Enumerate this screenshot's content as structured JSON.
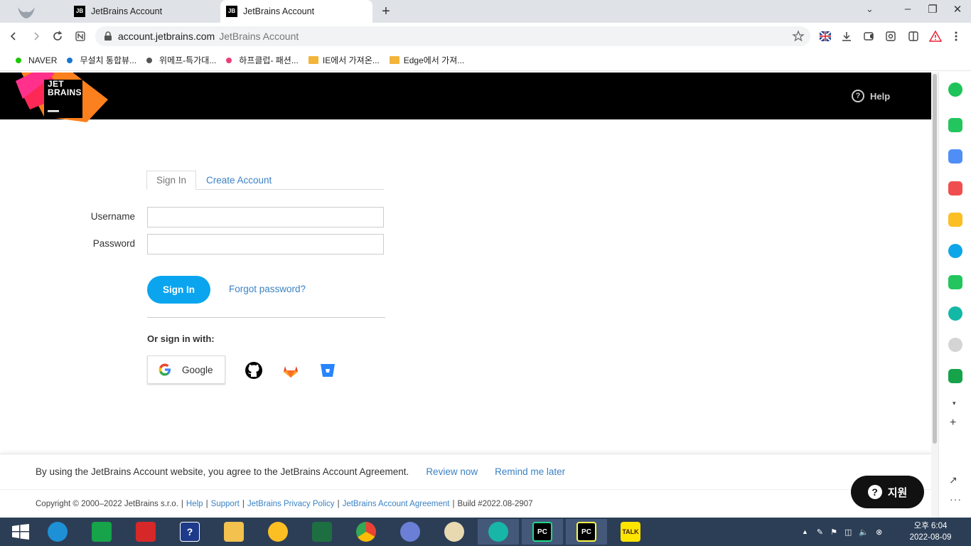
{
  "browser": {
    "tabs": [
      {
        "title": "JetBrains Account",
        "favicon": "JB",
        "active": false
      },
      {
        "title": "JetBrains Account",
        "favicon": "JB",
        "active": true
      }
    ],
    "new_tab_label": "+",
    "url": "account.jetbrains.com",
    "page_title_hint": "JetBrains Account",
    "bookmarks": [
      {
        "label": "NAVER",
        "kind": "dot",
        "color": "#1ec800"
      },
      {
        "label": "무설치 통합뷰...",
        "kind": "dot",
        "color": "#1877d2"
      },
      {
        "label": "위메프-특가대...",
        "kind": "dot",
        "color": "#555555"
      },
      {
        "label": "하프클럽- 패션...",
        "kind": "dot",
        "color": "#e8407a"
      },
      {
        "label": "IE에서 가져온...",
        "kind": "folder"
      },
      {
        "label": "Edge에서 가져...",
        "kind": "folder"
      }
    ]
  },
  "site": {
    "logo_text_line1": "JET",
    "logo_text_line2": "BRAINS",
    "help_label": "Help"
  },
  "form": {
    "tab_signin": "Sign In",
    "tab_create": "Create Account",
    "username_label": "Username",
    "password_label": "Password",
    "username_value": "",
    "password_value": "",
    "signin_button": "Sign In",
    "forgot_link": "Forgot password?",
    "or_sign_in_with": "Or sign in with:",
    "google_label": "Google"
  },
  "consent": {
    "text": "By using the JetBrains Account website, you agree to the JetBrains Account Agreement.",
    "review": "Review now",
    "remind": "Remind me later"
  },
  "footer": {
    "copyright": "Copyright © 2000–2022 JetBrains s.r.o.",
    "links": [
      "Help",
      "Support",
      "JetBrains Privacy Policy",
      "JetBrains Account Agreement"
    ],
    "build": "Build #2022.08-2907"
  },
  "support_button": "지원",
  "taskbar": {
    "clock_time": "오후 6:04",
    "clock_date": "2022-08-09",
    "pycharm_label": "PC",
    "kakao_label": "TALK"
  },
  "colors": {
    "accent_blue": "#0aa5ee",
    "link_blue": "#3b82c4",
    "header_black": "#000000"
  }
}
